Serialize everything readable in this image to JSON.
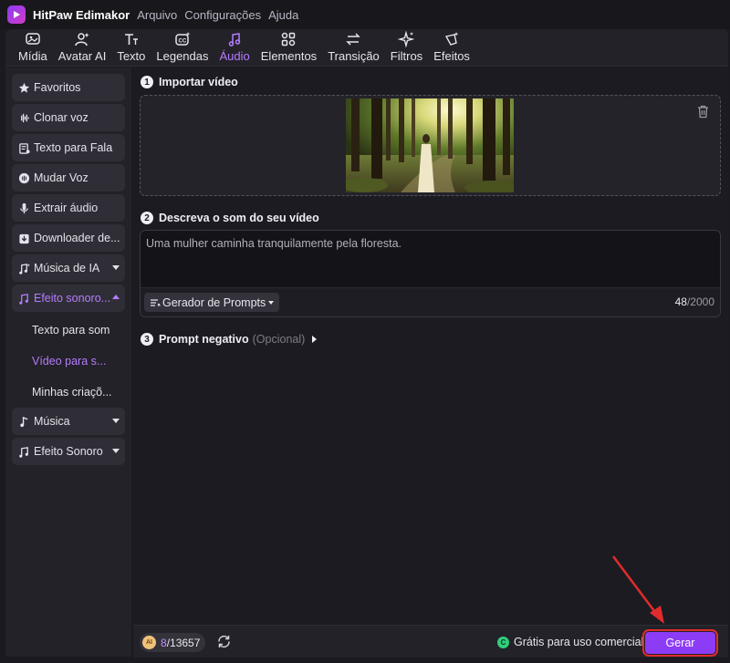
{
  "app": {
    "name": "HitPaw Edimakor",
    "menu": [
      "Arquivo",
      "Configurações",
      "Ajuda"
    ]
  },
  "toolbar": {
    "items": [
      {
        "label": "Mídia",
        "icon": "media-icon"
      },
      {
        "label": "Avatar AI",
        "icon": "avatar-icon"
      },
      {
        "label": "Texto",
        "icon": "text-icon"
      },
      {
        "label": "Legendas",
        "icon": "subtitles-icon"
      },
      {
        "label": "Áudio",
        "icon": "audio-icon",
        "active": true
      },
      {
        "label": "Elementos",
        "icon": "elements-icon"
      },
      {
        "label": "Transição",
        "icon": "transition-icon"
      },
      {
        "label": "Filtros",
        "icon": "filters-icon"
      },
      {
        "label": "Efeitos",
        "icon": "effects-icon"
      }
    ],
    "accent": "#b57cff"
  },
  "sidebar": {
    "items": [
      {
        "label": "Favoritos",
        "icon": "star-icon"
      },
      {
        "label": "Clonar voz",
        "icon": "waveform-icon"
      },
      {
        "label": "Texto para Fala",
        "icon": "text-to-speech-icon"
      },
      {
        "label": "Mudar Voz",
        "icon": "voice-change-icon"
      },
      {
        "label": "Extrair áudio",
        "icon": "microphone-icon"
      },
      {
        "label": "Downloader de...",
        "icon": "download-icon"
      },
      {
        "label": "Música de IA",
        "icon": "ai-music-icon"
      },
      {
        "label": "Efeito sonoro...",
        "icon": "sound-effect-icon"
      }
    ],
    "subitems": [
      "Texto para som",
      "Vídeo para s...",
      "Minhas criaçõ..."
    ],
    "after": [
      {
        "label": "Música",
        "icon": "music-icon"
      },
      {
        "label": "Efeito Sonoro",
        "icon": "sound-effect-icon"
      }
    ]
  },
  "main": {
    "step1": {
      "num": "1",
      "title": "Importar vídeo"
    },
    "step2": {
      "num": "2",
      "title": "Descreva o som do seu vídeo"
    },
    "prompt_text": "Uma mulher caminha tranquilamente pela floresta.",
    "prompt_generator": "Gerador de Prompts",
    "char_count": "48",
    "char_max": "/2000",
    "step3": {
      "num": "3",
      "title": "Prompt negativo",
      "optional": "(Opcional)"
    }
  },
  "bottom": {
    "credits_used": "8",
    "credits_total": "/13657",
    "coin_label": "AI",
    "free_badge": "C",
    "free_text": "Grátis para uso comercial",
    "generate": "Gerar",
    "generate_color": "#8b3cf4",
    "highlight_color": "#e02c2c"
  }
}
